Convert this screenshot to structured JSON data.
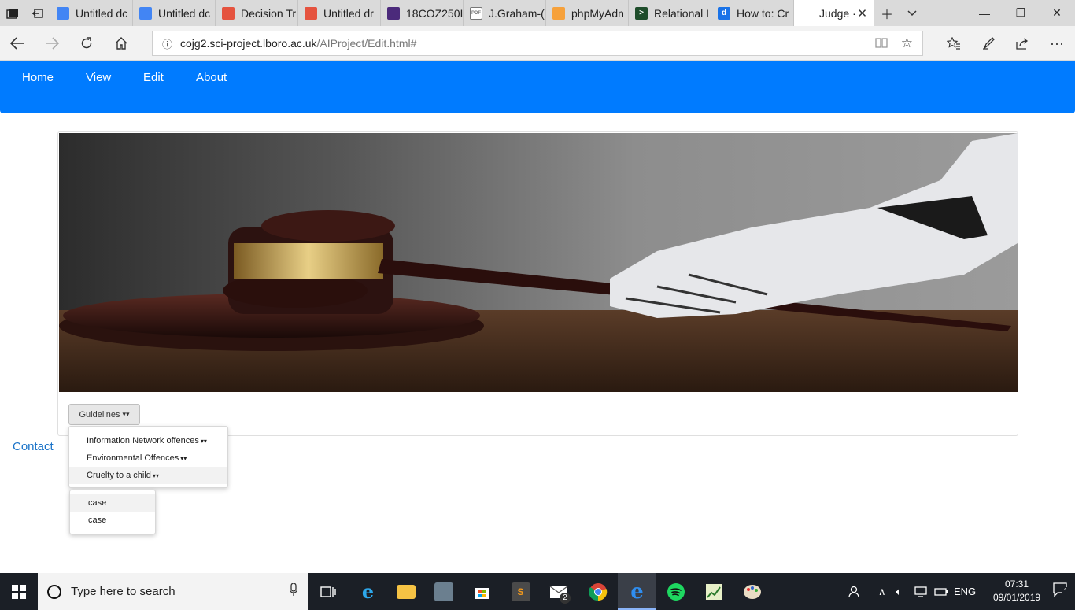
{
  "browser": {
    "tabs": [
      {
        "title": "Untitled dc",
        "icon": "google-docs-icon",
        "color": "#4285f4"
      },
      {
        "title": "Untitled dc",
        "icon": "google-docs-icon",
        "color": "#4285f4"
      },
      {
        "title": "Decision Tr",
        "icon": "draw-io-icon",
        "color": "#e5533f"
      },
      {
        "title": "Untitled dr",
        "icon": "draw-io-icon",
        "color": "#e5533f"
      },
      {
        "title": "18COZ250I",
        "icon": "university-shield-icon",
        "color": "#4b2a7b"
      },
      {
        "title": "J.Graham-(",
        "icon": "pdf-icon",
        "color": "#ffffff"
      },
      {
        "title": "phpMyAdn",
        "icon": "phpmyadmin-icon",
        "color": "#f6a13b"
      },
      {
        "title": "Relational I",
        "icon": "terminal-icon",
        "color": "#1e4d2b"
      },
      {
        "title": "How to: Cr",
        "icon": "dictionary-icon",
        "color": "#1a73e8"
      },
      {
        "title": "Judge ·",
        "icon": "",
        "color": ""
      }
    ],
    "url_host": "cojg2.sci-project.lboro.ac.uk",
    "url_path": "/AIProject/Edit.html#"
  },
  "site_nav": {
    "items": [
      "Home",
      "View",
      "Edit",
      "About"
    ],
    "color": "#007bff"
  },
  "guidelines_button": "Guidelines",
  "guidelines_menu": [
    "Information Network offences",
    "Environmental Offences",
    "Cruelty to a child"
  ],
  "sub_menu": [
    "case",
    "case"
  ],
  "contact_link": "Contact",
  "taskbar": {
    "search_placeholder": "Type here to search",
    "mail_badge": "2",
    "language": "ENG",
    "time": "07:31",
    "date": "09/01/2019",
    "notification_count": "1"
  }
}
